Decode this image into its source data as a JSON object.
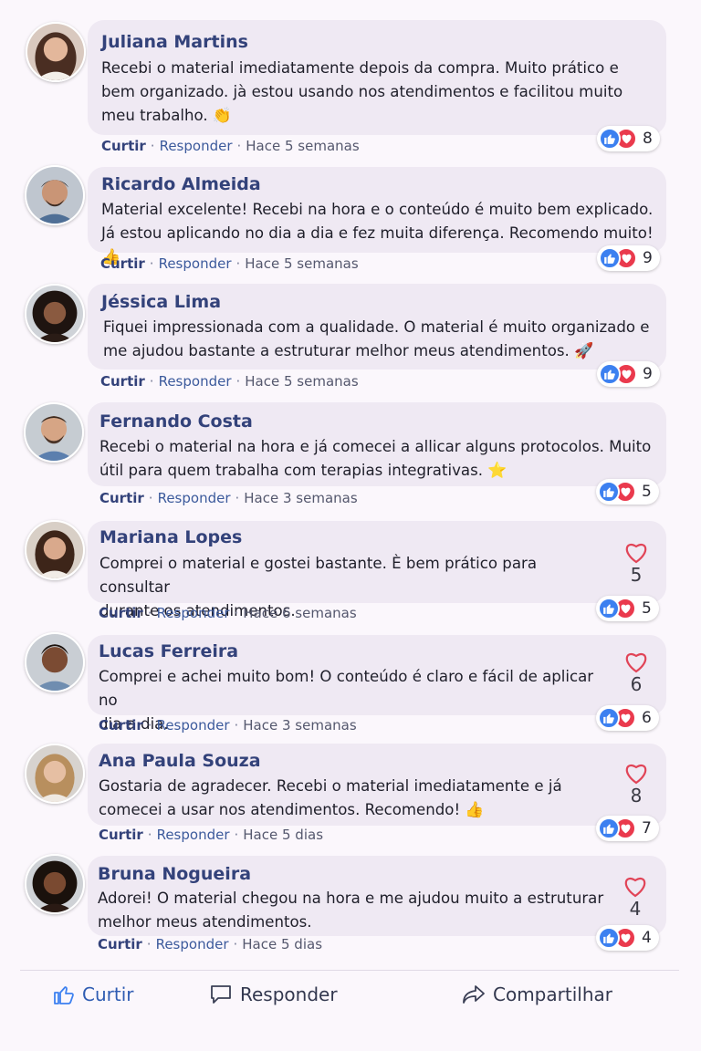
{
  "comments": [
    {
      "author": "Juliana Martins",
      "text_lines": [
        "Recebi o material imediatamente depois da compra. Muito prático e",
        "bem organizado. jà estou usando nos atendimentos e facilitou muito",
        "meu trabalho."
      ],
      "emoji": "👏",
      "like_label": "Curtir",
      "reply_label": "Responder",
      "time": "Hace 5 semanas",
      "reaction_count": "8",
      "side_count": null
    },
    {
      "author": "Ricardo Almeida",
      "text_lines": [
        "Material excelente! Recebi na hora e o conteúdo é muito bem explicado.",
        "Já estou aplicando no dia a dia e fez muita diferença. Recomendo muito!"
      ],
      "emoji": "👍",
      "like_label": "Curtir",
      "reply_label": "Responder",
      "time": "Hace 5 semanas",
      "reaction_count": "9",
      "side_count": null
    },
    {
      "author": "Jéssica Lima",
      "text_lines": [
        "Fiquei impressionada com a qualidade. O material é muito organizado e",
        "me ajudou bastante a estruturar melhor meus atendimentos."
      ],
      "emoji": "🚀",
      "like_label": "Curtir",
      "reply_label": "Responder",
      "time": "Hace 5 semanas",
      "reaction_count": "9",
      "side_count": null
    },
    {
      "author": "Fernando Costa",
      "text_lines": [
        "Recebi o material na hora e já comecei a allicar alguns protocolos. Muito",
        "útil para quem trabalha com terapias integrativas."
      ],
      "emoji": "⭐",
      "like_label": "Curtir",
      "reply_label": "Responder",
      "time": "Hace 3 semanas",
      "reaction_count": "5",
      "side_count": null
    },
    {
      "author": "Mariana Lopes",
      "text_lines": [
        "Comprei o material e gostei bastante. È bem prático para consultar",
        "durante os atendimentos."
      ],
      "emoji": "",
      "like_label": "Curtir",
      "reply_label": "Responder",
      "time": "Hace 6 semanas",
      "reaction_count": "5",
      "side_count": "5"
    },
    {
      "author": "Lucas Ferreira",
      "text_lines": [
        "Comprei e achei muito bom! O conteúdo é claro e fácil de aplicar no",
        "dia a dia."
      ],
      "emoji": "",
      "like_label": "Curtir",
      "reply_label": "Responder",
      "time": "Hace 3 semanas",
      "reaction_count": "6",
      "side_count": "6"
    },
    {
      "author": "Ana Paula Souza",
      "text_lines": [
        "Gostaria de agradecer. Recebi o material imediatamente e já",
        "comecei a usar nos atendimentos. Recomendo!"
      ],
      "emoji": "👍",
      "like_label": "Curtir",
      "reply_label": "Responder",
      "time": "Hace 5 dias",
      "reaction_count": "7",
      "side_count": "8"
    },
    {
      "author": "Bruna Nogueira",
      "text_lines": [
        "Adorei! O material chegou na hora e me ajudou muito a estruturar",
        "melhor meus atendimentos."
      ],
      "emoji": "",
      "like_label": "Curtir",
      "reply_label": "Responder",
      "time": "Hace 5 dias",
      "reaction_count": "4",
      "side_count": "4"
    }
  ],
  "action_bar": {
    "like": "Curtir",
    "reply": "Responder",
    "share": "Compartilhar"
  },
  "colors": {
    "like_blue": "#3c80f0",
    "love_red": "#ea3a4d",
    "author_navy": "#33427a",
    "bubble_bg": "#efe9f3"
  },
  "icons": [
    "thumbs-up-icon",
    "heart-icon",
    "comment-icon",
    "share-arrow-icon"
  ]
}
